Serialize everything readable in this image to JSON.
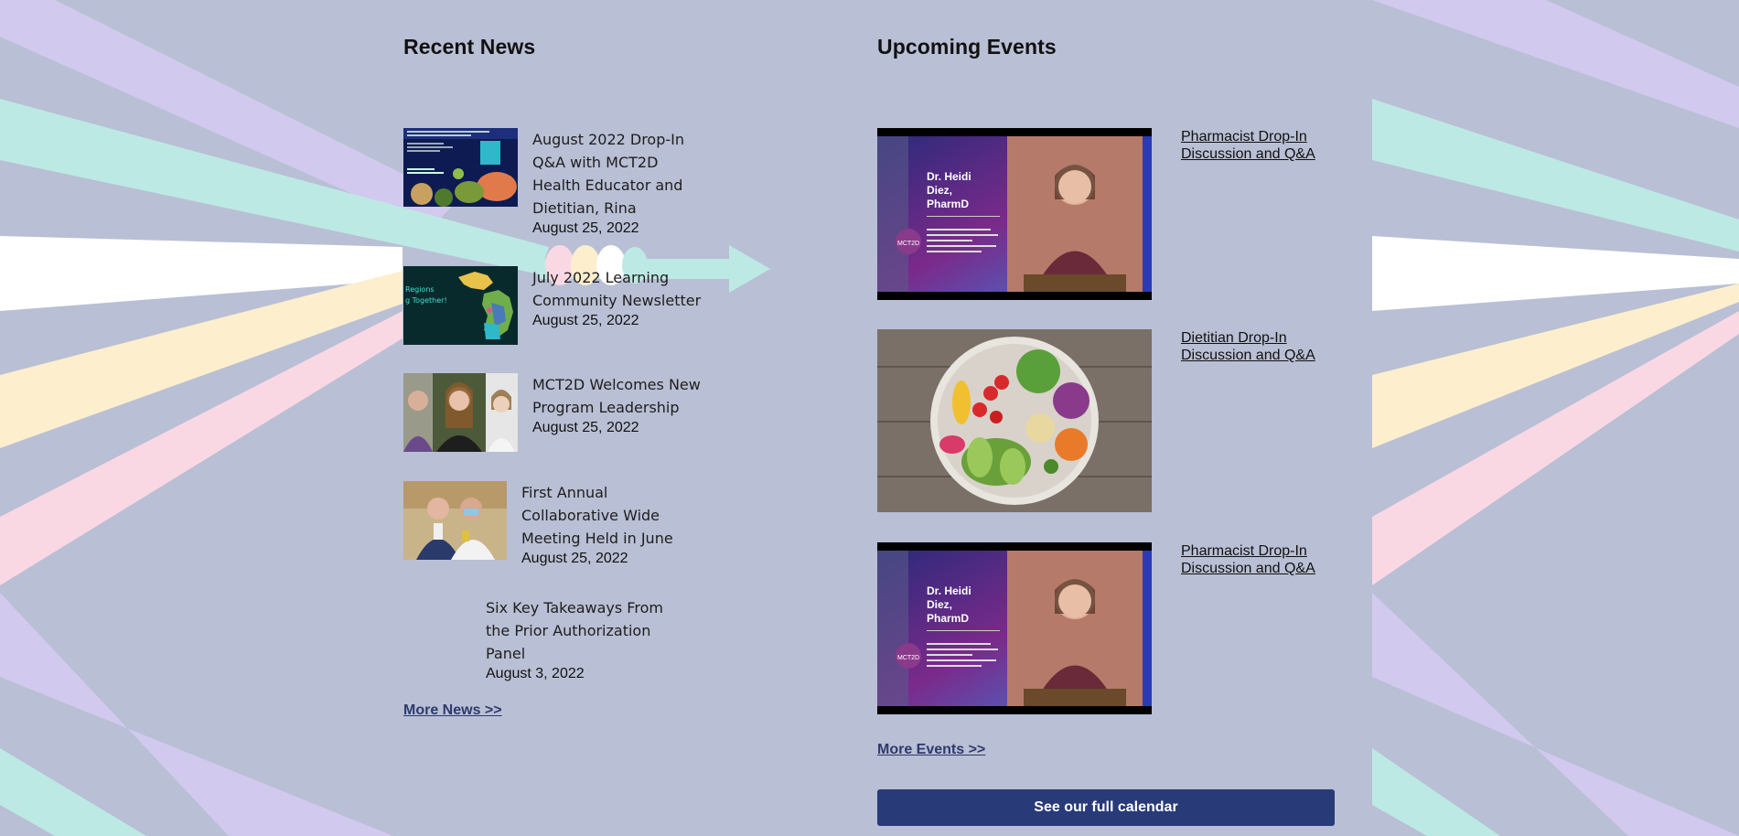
{
  "news": {
    "heading": "Recent News",
    "items": [
      {
        "title": "August 2022 Drop-In Q&A with MCT2D Health Educator and Dietitian, Rina",
        "date": "August 25, 2022",
        "thumbnail": "collage-flyer-image"
      },
      {
        "title": "July 2022 Learning Community Newsletter",
        "date": "August 25, 2022",
        "thumbnail": "michigan-map-image"
      },
      {
        "title": "MCT2D Welcomes New Program Leadership",
        "date": "August 25, 2022",
        "thumbnail": "leadership-headshots-image"
      },
      {
        "title": "First Annual Collaborative Wide Meeting Held in June",
        "date": "August 25, 2022",
        "thumbnail": "meeting-photo-image"
      },
      {
        "title": "Six Key Takeaways From the Prior Authorization Panel",
        "date": "August 3, 2022"
      }
    ],
    "more_label": "More News >>"
  },
  "events": {
    "heading": "Upcoming Events",
    "items": [
      {
        "title": "Pharmacist Drop-In Discussion and Q&A",
        "thumbnail": "video-thumbnail"
      },
      {
        "title": "Dietitian Drop-In Discussion and Q&A",
        "thumbnail": "salad-bowl-image"
      },
      {
        "title": "Pharmacist Drop-In Discussion and Q&A",
        "thumbnail": "video-thumbnail"
      }
    ],
    "more_label": "More Events >>",
    "calendar_button": "See our full calendar"
  },
  "video_card": {
    "name_line1": "Dr. Heidi",
    "name_line2": "Diez,",
    "name_line3": "PharmD",
    "logo": "MCT2D"
  },
  "colors": {
    "background": "#b9bfd4",
    "stripe_lavender": "#d2c9ef",
    "stripe_mint": "#bde9e4",
    "stripe_white": "#ffffff",
    "stripe_cream": "#fdefcd",
    "stripe_pink": "#fad8e3",
    "button": "#283a78",
    "link": "#2c3a6e"
  }
}
